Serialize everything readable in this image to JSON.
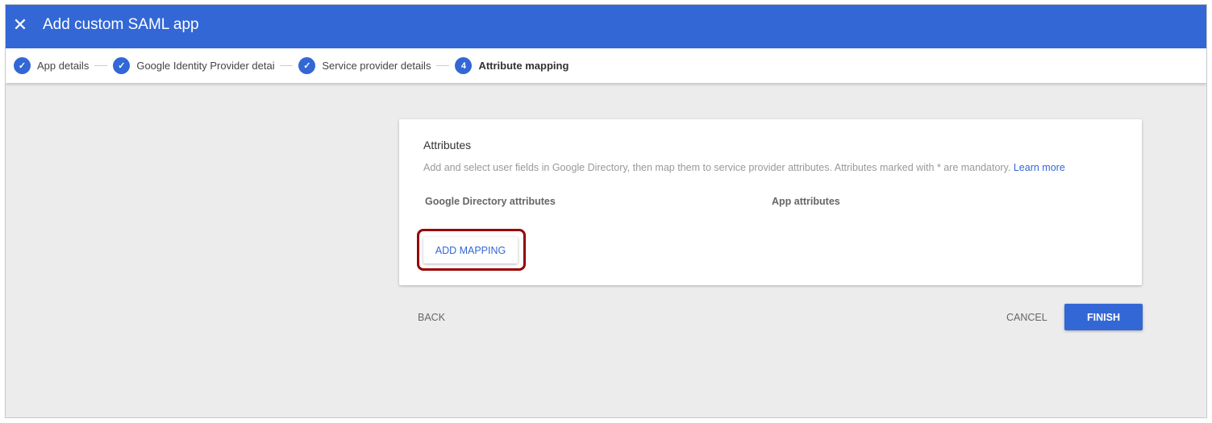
{
  "header": {
    "title": "Add custom SAML app",
    "close_icon": "close-icon"
  },
  "stepper": [
    {
      "label": "App details",
      "state": "done"
    },
    {
      "label": "Google Identity Provider details",
      "state": "done"
    },
    {
      "label": "Service provider details",
      "state": "done"
    },
    {
      "label": "Attribute mapping",
      "number": "4",
      "state": "active"
    }
  ],
  "card": {
    "title": "Attributes",
    "description": "Add and select user fields in Google Directory, then map them to service provider attributes. Attributes marked with * are mandatory.",
    "learn_more": "Learn more",
    "col_google": "Google Directory attributes",
    "col_app": "App attributes",
    "add_mapping": "ADD MAPPING"
  },
  "footer": {
    "back": "BACK",
    "cancel": "CANCEL",
    "finish": "FINISH"
  },
  "colors": {
    "primary": "#3367d6",
    "highlight": "#990000"
  }
}
